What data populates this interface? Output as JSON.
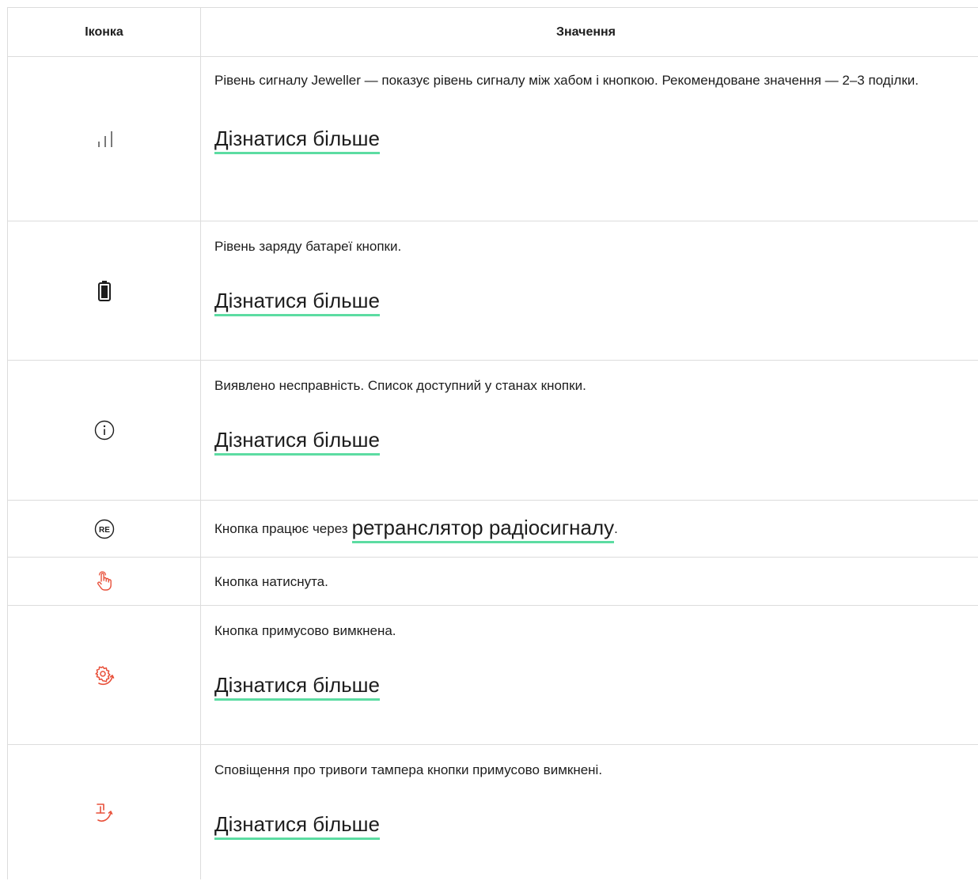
{
  "header": {
    "col_icon": "Іконка",
    "col_meaning": "Значення"
  },
  "accent_color": "#5cdca2",
  "icon_red": "#e8503a",
  "rows": [
    {
      "icon": "signal-strength-icon",
      "text": "Рівень сигналу Jeweller — показує рівень сигналу між хабом і кнопкою. Рекомендоване значення — 2–3 поділки.",
      "link": "Дізнатися більше"
    },
    {
      "icon": "battery-icon",
      "text": "Рівень заряду батареї кнопки.",
      "link": "Дізнатися більше"
    },
    {
      "icon": "info-icon",
      "text": "Виявлено несправність. Список доступний у станах кнопки.",
      "link": "Дізнатися більше"
    },
    {
      "icon": "repeater-re-icon",
      "text_before": "Кнопка працює через",
      "link": "ретранслятор радіосигналу",
      "text_after": "."
    },
    {
      "icon": "button-pressed-hand-icon",
      "text": "Кнопка натиснута."
    },
    {
      "icon": "forced-disable-gear-icon",
      "text": "Кнопка примусово вимкнена.",
      "link": "Дізнатися більше"
    },
    {
      "icon": "tamper-disabled-icon",
      "text": "Сповіщення про тривоги тампера кнопки примусово вимкнені.",
      "link": "Дізнатися більше"
    }
  ]
}
